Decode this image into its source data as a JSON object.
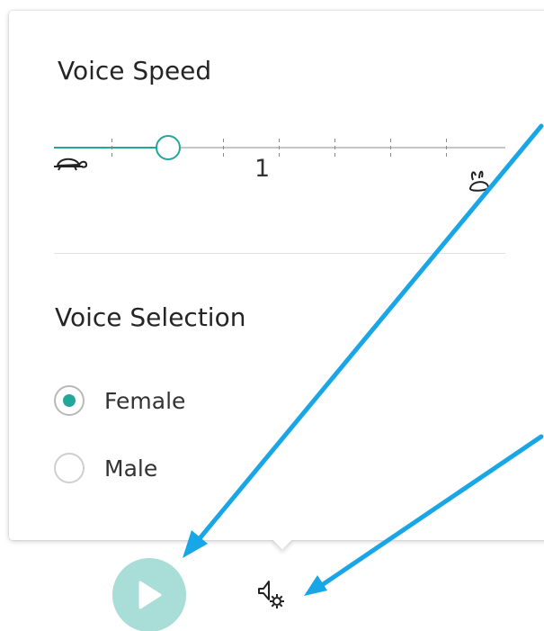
{
  "voice_speed": {
    "heading": "Voice Speed",
    "value_label": "1",
    "slider_level_fraction": 0.25,
    "tick_count": 7,
    "slow_icon": "turtle-icon",
    "fast_icon": "rabbit-icon"
  },
  "voice_selection": {
    "heading": "Voice Selection",
    "options": [
      {
        "label": "Female",
        "selected": true
      },
      {
        "label": "Male",
        "selected": false
      }
    ]
  },
  "toolbar": {
    "play_icon": "play-icon",
    "voice_settings_icon": "voice-settings-icon"
  },
  "colors": {
    "accent": "#23a79a",
    "play_button": "#a8ddd8",
    "annotation_arrow": "#19a6e6"
  }
}
